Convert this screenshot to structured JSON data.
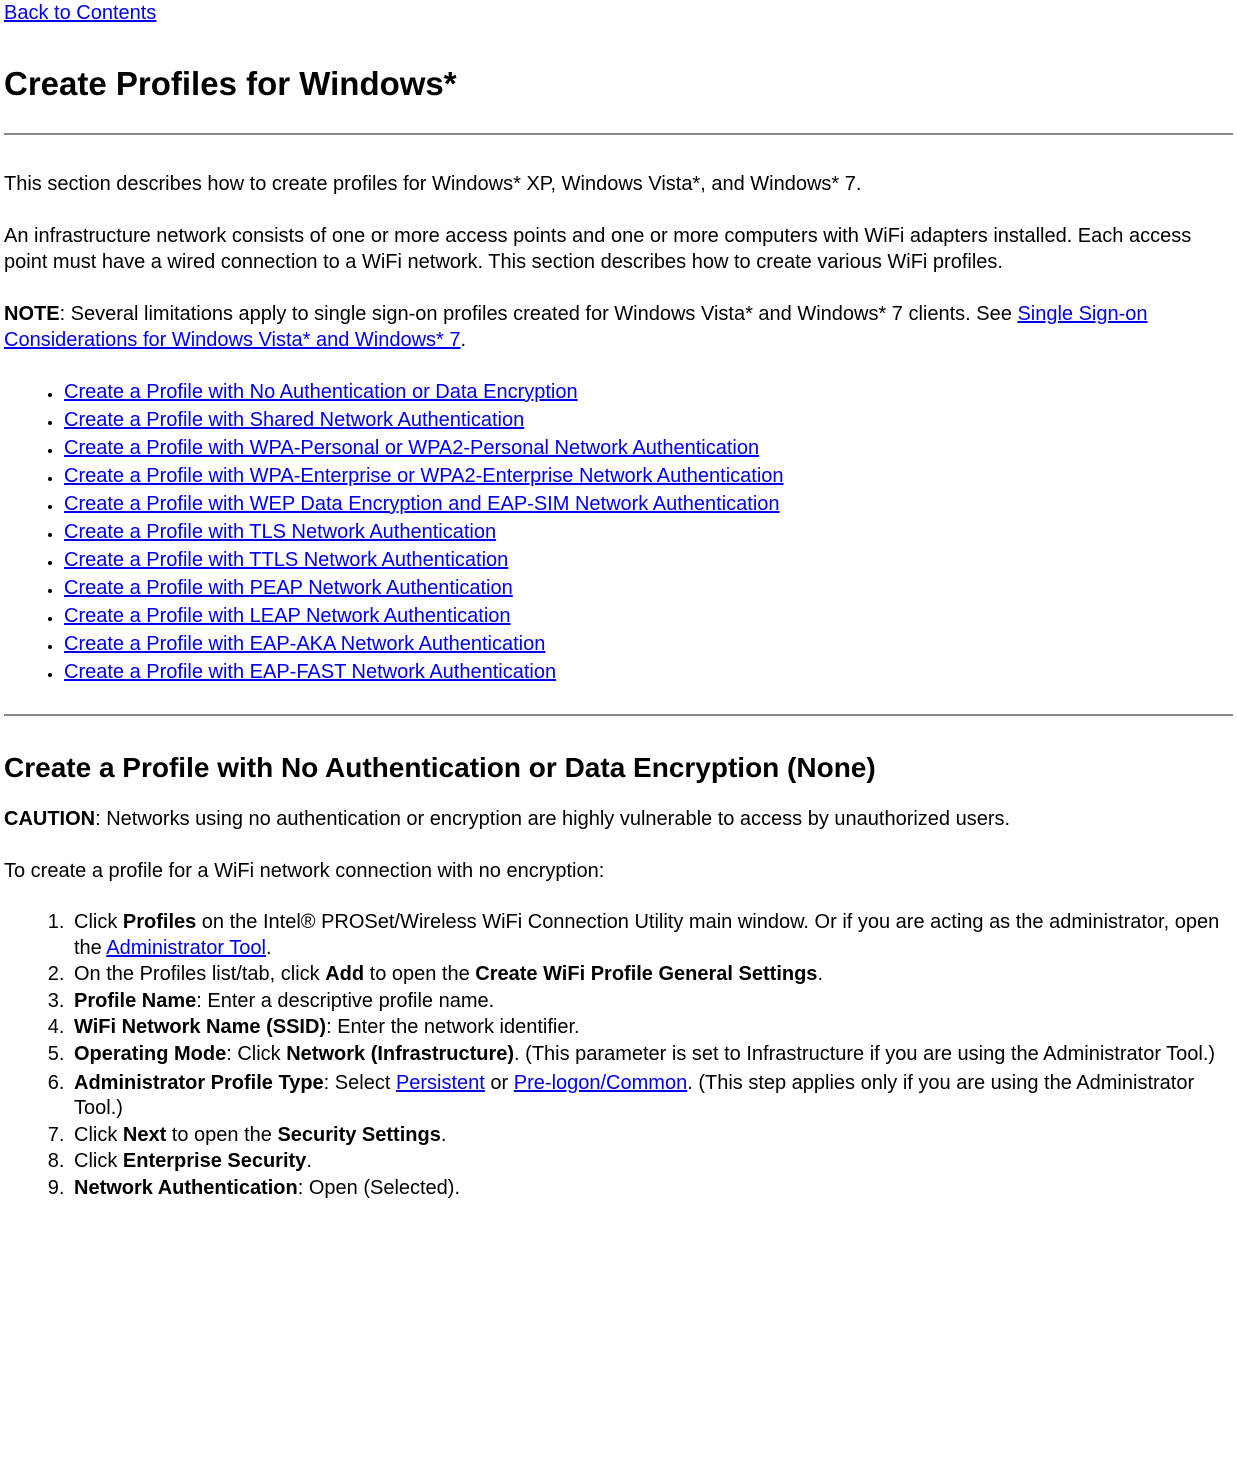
{
  "backLink": "Back to Contents",
  "title": "Create Profiles for Windows*",
  "intro1": "This section describes how to create profiles for Windows* XP, Windows Vista*, and Windows* 7.",
  "intro2": "An infrastructure network consists of one or more access points and one or more computers with WiFi adapters installed. Each access point must have a wired connection to a WiFi network. This section describes how to create various WiFi profiles.",
  "noteLabel": "NOTE",
  "noteBody": ": Several limitations apply to single sign-on profiles created for Windows Vista* and Windows* 7 clients. See ",
  "noteLink": "Single Sign-on Considerations for Windows Vista* and Windows* 7",
  "noteAfter": ".",
  "profileLinks": [
    "Create a Profile with No Authentication or Data Encryption",
    "Create a Profile with Shared Network Authentication",
    "Create a Profile with WPA-Personal or WPA2-Personal Network Authentication",
    "Create a Profile with WPA-Enterprise or WPA2-Enterprise Network Authentication",
    "Create a Profile with WEP Data Encryption and EAP-SIM Network Authentication",
    "Create a Profile with TLS Network Authentication",
    "Create a Profile with TTLS Network Authentication",
    "Create a Profile with PEAP Network Authentication",
    "Create a Profile with LEAP Network Authentication",
    "Create a Profile with EAP-AKA Network Authentication",
    "Create a Profile with EAP-FAST Network Authentication"
  ],
  "section1": {
    "title": "Create a Profile with No Authentication or Data Encryption (None)",
    "cautionLabel": "CAUTION",
    "cautionBody": ": Networks using no authentication or encryption are highly vulnerable to access by unauthorized users.",
    "lead": "To create a profile for a WiFi network connection with no encryption:",
    "steps": {
      "s1a": "Click ",
      "s1b": "Profiles",
      "s1c": " on the Intel® PROSet/Wireless WiFi Connection Utility main window. Or if you are acting as the administrator, open the ",
      "s1link": "Administrator Tool",
      "s1d": ".",
      "s2a": "On the Profiles list/tab, click ",
      "s2b": "Add",
      "s2c": " to open the ",
      "s2d": "Create WiFi Profile General Settings",
      "s2e": ".",
      "s3a": "Profile Name",
      "s3b": ": Enter a descriptive profile name.",
      "s4a": "WiFi Network Name (SSID)",
      "s4b": ": Enter the network identifier.",
      "s5a": "Operating Mode",
      "s5b": ": Click ",
      "s5c": "Network (Infrastructure)",
      "s5d": ". (This parameter is set to Infrastructure if you are using the Administrator Tool.)",
      "s6a": "Administrator Profile Type",
      "s6b": ": Select ",
      "s6link1": "Persistent",
      "s6c": " or ",
      "s6link2": "Pre-logon/Common",
      "s6d": ". (This step applies only if you are using the Administrator Tool.)",
      "s7a": "Click ",
      "s7b": "Next",
      "s7c": " to open the ",
      "s7d": "Security Settings",
      "s7e": ".",
      "s8a": "Click ",
      "s8b": "Enterprise Security",
      "s8c": ".",
      "s9a": "Network Authentication",
      "s9b": ": Open (Selected)."
    }
  }
}
